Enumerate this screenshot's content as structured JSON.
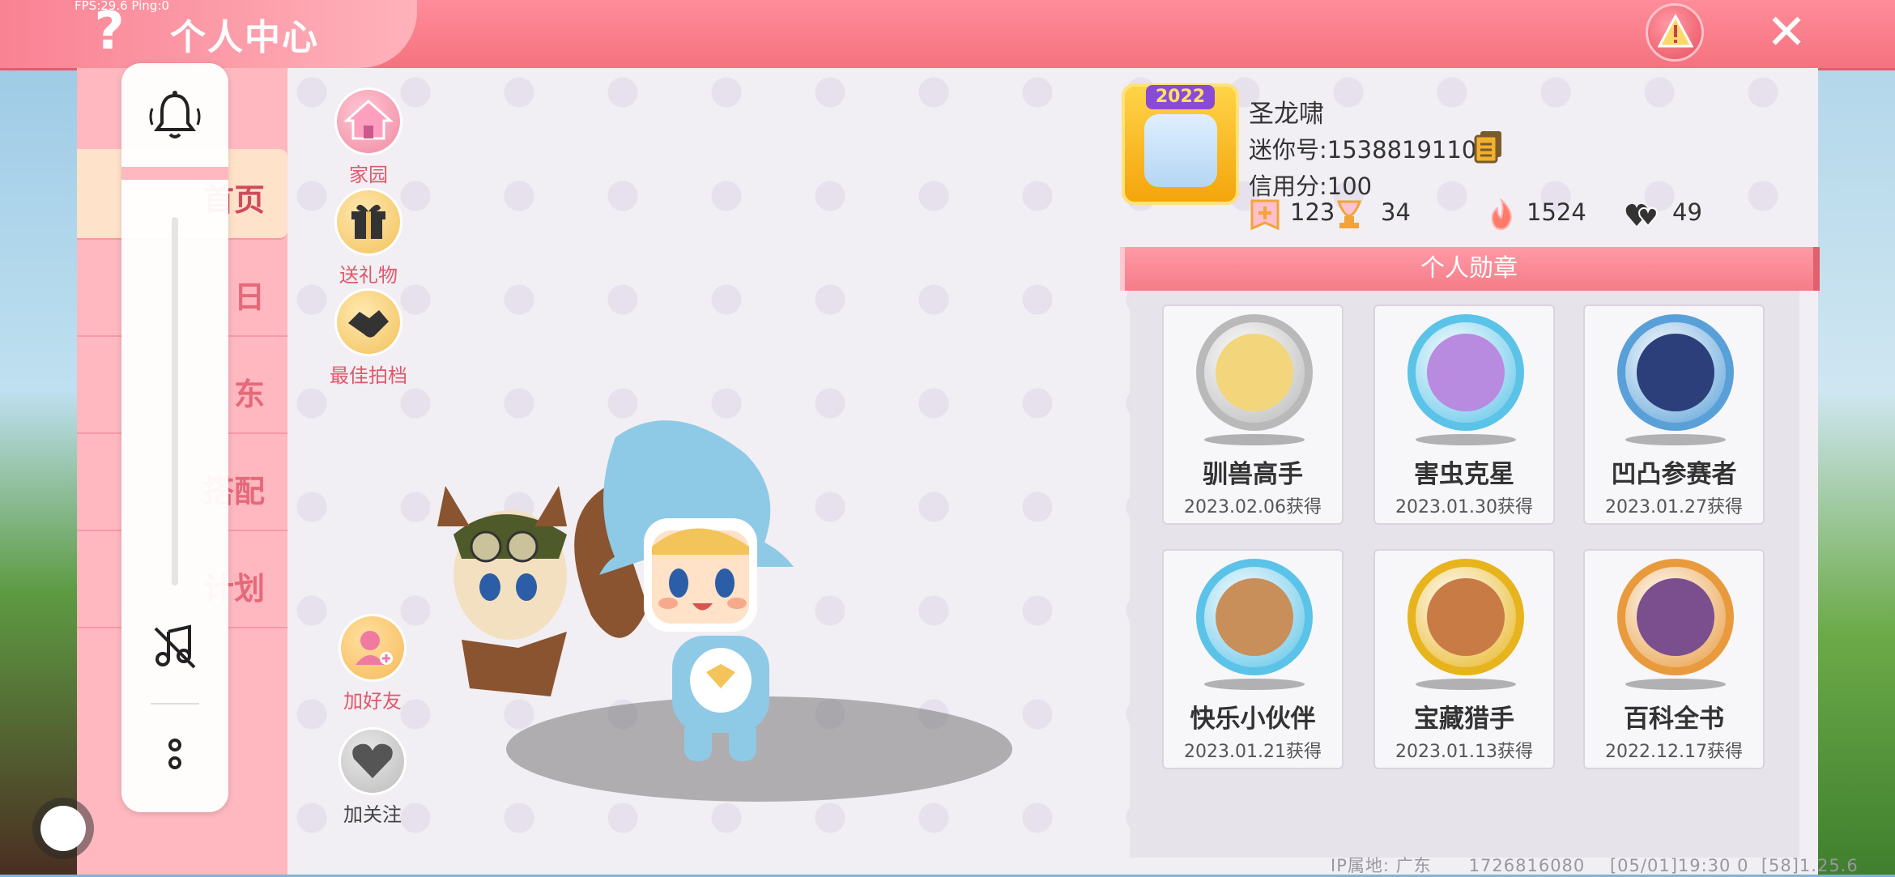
{
  "status": {
    "fps_text": "FPS:29.6  Ping:0"
  },
  "header": {
    "title": "个人中心",
    "help_label": "?",
    "close_label": "✕"
  },
  "sidebar": {
    "tabs": [
      {
        "label": "首页",
        "active": true
      },
      {
        "label": "日"
      },
      {
        "label": "东"
      },
      {
        "label": "搭配"
      },
      {
        "label": "计划"
      }
    ]
  },
  "volume": {
    "level": 0.0
  },
  "actions": {
    "home": "家园",
    "gift": "送礼物",
    "partner": "最佳拍档",
    "add_friend": "加好友",
    "follow": "加关注"
  },
  "profile": {
    "avatar_year": "2022",
    "name": "圣龙啸",
    "mini_id": "迷你号:1538819110",
    "credit": "信用分:100",
    "stats": {
      "likes": "123",
      "trophies": "34",
      "heat": "1524",
      "hearts": "49"
    }
  },
  "medals": {
    "header": "个人勋章",
    "items": [
      {
        "name": "驯兽高手",
        "date": "2023.02.06获得",
        "ring": "#b9b9b9",
        "inner": "#f3d67c"
      },
      {
        "name": "害虫克星",
        "date": "2023.01.30获得",
        "ring": "#5bc3e8",
        "inner": "#b98be0"
      },
      {
        "name": "凹凸参赛者",
        "date": "2023.01.27获得",
        "ring": "#5aa0d8",
        "inner": "#2c3f7a"
      },
      {
        "name": "快乐小伙伴",
        "date": "2023.01.21获得",
        "ring": "#5bc3e8",
        "inner": "#c98f5a"
      },
      {
        "name": "宝藏猎手",
        "date": "2023.01.13获得",
        "ring": "#e8b41e",
        "inner": "#c97b45"
      },
      {
        "name": "百科全书",
        "date": "2022.12.17获得",
        "ring": "#e89a3c",
        "inner": "#7b4f8e"
      }
    ]
  },
  "footer": {
    "ip": "IP属地: 广东",
    "uid": "1726816080",
    "time": "[05/01]19:30 0",
    "version": "[58]1.25.6"
  },
  "colors": {
    "accent": "#f5727f",
    "panel": "#f1eef4"
  }
}
